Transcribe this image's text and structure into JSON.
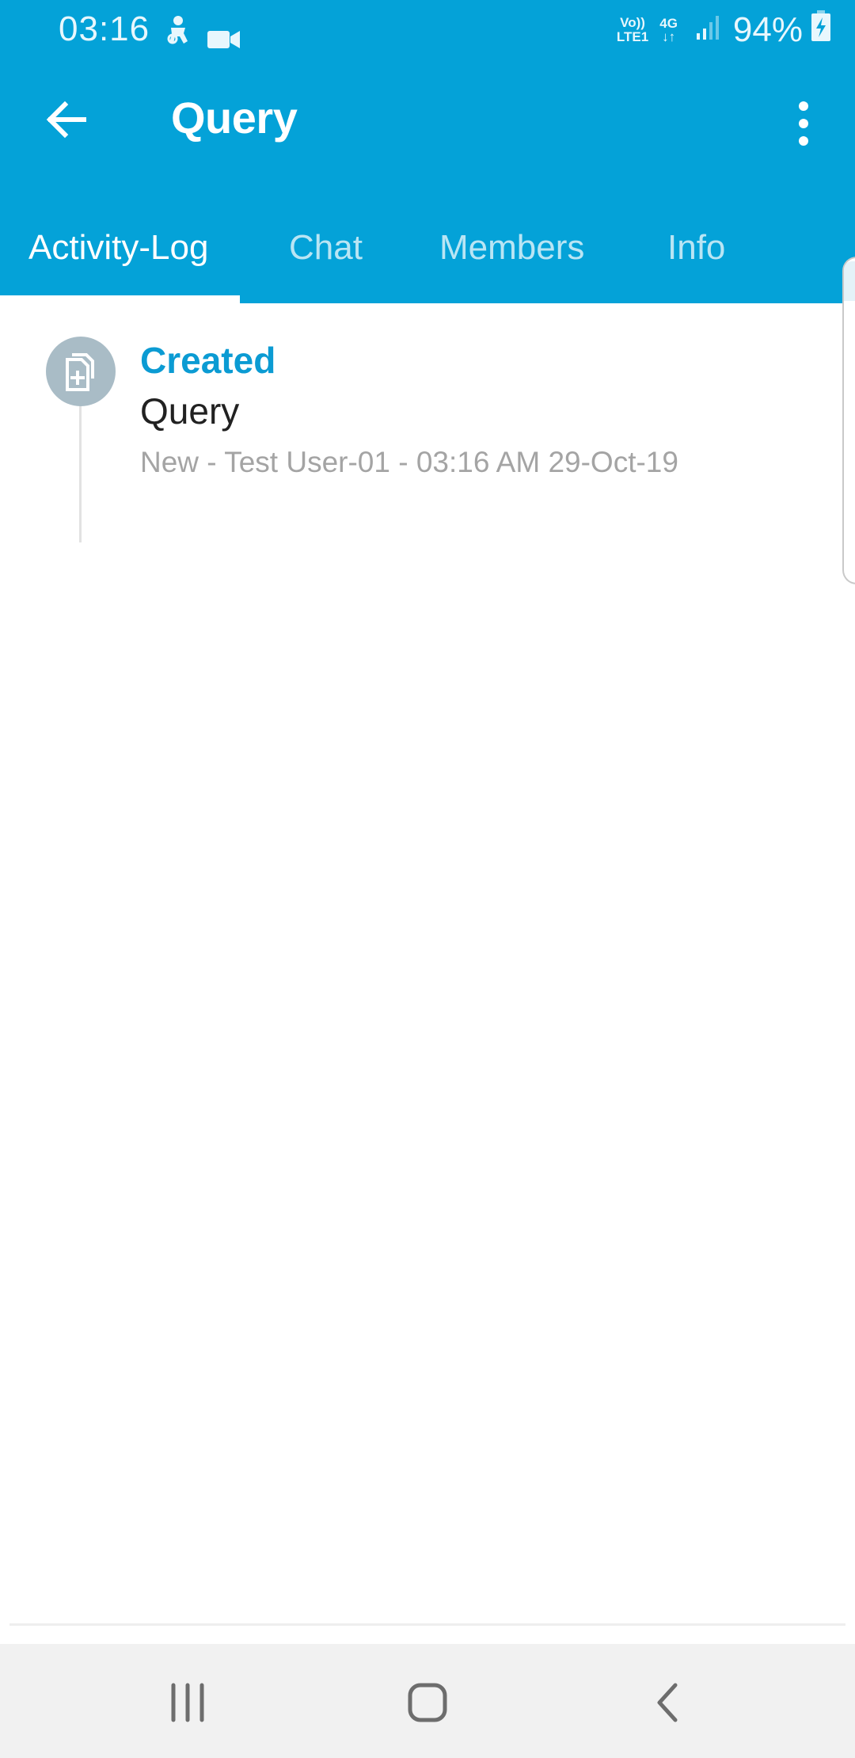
{
  "status_bar": {
    "time": "03:16",
    "volte_line1": "Vo))",
    "volte_line2": "LTE1",
    "network": "4G",
    "battery_percent": "94%",
    "icons": [
      "accessibility-icon",
      "video-camera-icon",
      "signal-icon",
      "battery-charging-icon"
    ]
  },
  "app_bar": {
    "title": "Query",
    "back_icon": "arrow-back-icon",
    "menu_icon": "more-vert-icon"
  },
  "tabs": [
    {
      "label": "Activity-Log",
      "active": true
    },
    {
      "label": "Chat",
      "active": false
    },
    {
      "label": "Members",
      "active": false
    },
    {
      "label": "Info",
      "active": false
    }
  ],
  "activity_log": [
    {
      "icon": "document-add-icon",
      "action": "Created",
      "subject": "Query",
      "meta": "New - Test User-01 - 03:16 AM 29-Oct-19"
    }
  ],
  "nav_bar": {
    "buttons": [
      "recent-apps-icon",
      "home-icon",
      "back-icon"
    ]
  },
  "colors": {
    "primary": "#04a2d8",
    "accent_text": "#0b9bd3",
    "icon_circle": "#a9bcc6",
    "meta_text": "#a4a4a4"
  }
}
